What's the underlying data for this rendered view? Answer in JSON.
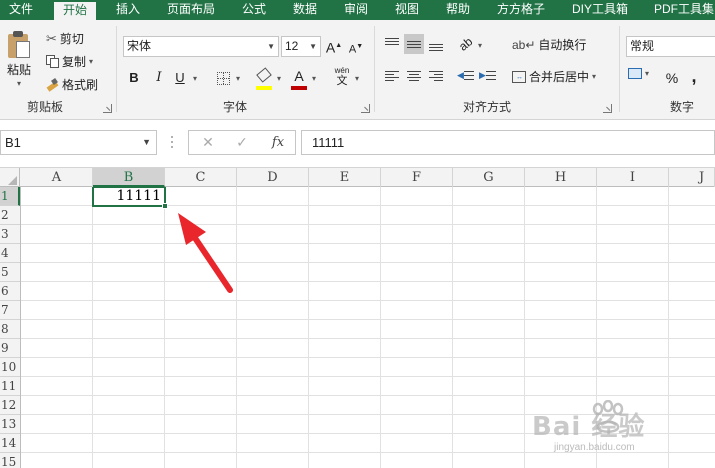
{
  "ribbon": {
    "tabs": [
      "文件",
      "开始",
      "插入",
      "页面布局",
      "公式",
      "数据",
      "审阅",
      "视图",
      "帮助",
      "方方格子",
      "DIY工具箱",
      "PDF工具集"
    ],
    "active_tab": "开始",
    "clipboard": {
      "paste": "粘贴",
      "cut": "剪切",
      "copy": "复制",
      "format_painter": "格式刷",
      "group": "剪贴板"
    },
    "font": {
      "name": "宋体",
      "size": "12",
      "grow": "A",
      "shrink": "A",
      "bold": "B",
      "italic": "I",
      "underline": "U",
      "font_color": "A",
      "phonetic": "wén",
      "phonetic_char": "文",
      "group": "字体",
      "highlight_color": "#ffff00",
      "font_color_value": "#c00000"
    },
    "alignment": {
      "wrap_text": "自动换行",
      "merge_center": "合并后居中",
      "group": "对齐方式"
    },
    "number": {
      "format": "常规",
      "percent": "%",
      "comma": ",",
      "group": "数字"
    },
    "accent_color": "#217346"
  },
  "formula_bar": {
    "name_box": "B1",
    "cancel": "✕",
    "enter": "✓",
    "fx": "fx",
    "content": "11111"
  },
  "sheet": {
    "columns": [
      "A",
      "B",
      "C",
      "D",
      "E",
      "F",
      "G",
      "H",
      "I",
      "J"
    ],
    "rows": [
      "1",
      "2",
      "3",
      "4",
      "5",
      "6",
      "7",
      "8",
      "9",
      "10",
      "11",
      "12",
      "13",
      "14",
      "15"
    ],
    "selected_cell": "B1",
    "cells": {
      "B1": "11111"
    }
  },
  "annotation": {
    "arrow_color": "#e8262b"
  },
  "watermark": {
    "brand": "Bai 经验",
    "url": "jingyan.baidu.com"
  }
}
